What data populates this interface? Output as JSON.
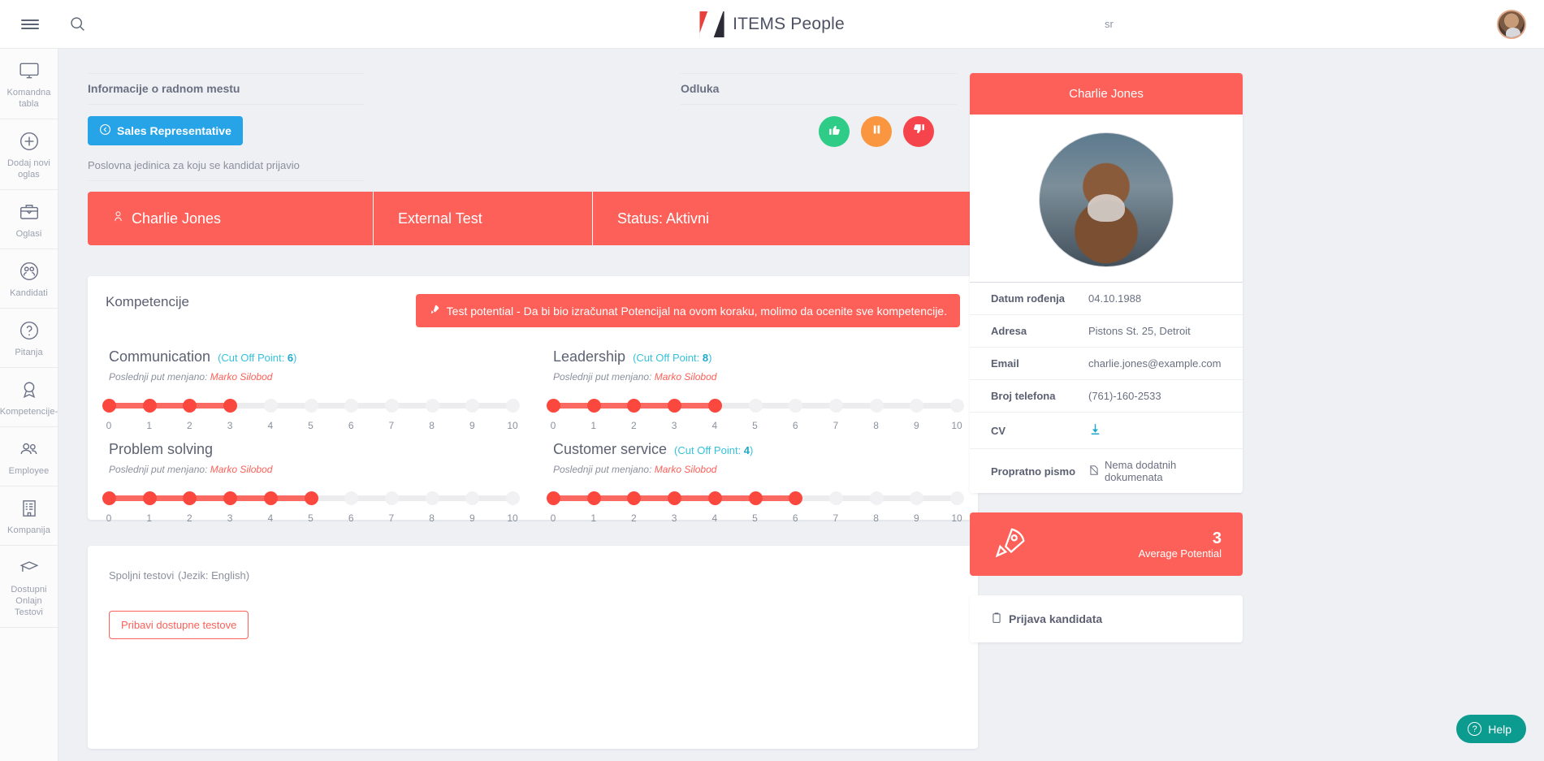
{
  "topbar": {
    "menu_icon": "hamburger-icon",
    "search_icon": "search-icon",
    "brand_title": "ITEMS People",
    "language": "sr",
    "avatar": "user-avatar"
  },
  "sidebar": {
    "items": [
      {
        "label": "Komandna tabla",
        "icon": "monitor-icon"
      },
      {
        "label": "Dodaj novi oglas",
        "icon": "plus-circle-icon"
      },
      {
        "label": "Oglasi",
        "icon": "briefcase-icon"
      },
      {
        "label": "Kandidati",
        "icon": "candidates-icon"
      },
      {
        "label": "Pitanja",
        "icon": "question-circle-icon"
      },
      {
        "label": "Kompetencije-",
        "icon": "award-icon"
      },
      {
        "label": "Employee",
        "icon": "people-icon"
      },
      {
        "label": "Kompanija",
        "icon": "building-icon"
      },
      {
        "label": "Dostupni Onlajn Testovi",
        "icon": "graduation-cap-icon"
      }
    ]
  },
  "job_info": {
    "section_title": "Informacije o radnom mestu",
    "job_button": "Sales Representative",
    "job_button_icon": "back-circle-icon",
    "subtitle": "Poslovna jedinica za koju se kandidat prijavio"
  },
  "decision": {
    "section_title": "Odluka",
    "buttons": [
      {
        "name": "approve",
        "icon": "thumbs-up-icon",
        "color": "#2ecc87"
      },
      {
        "name": "hold",
        "icon": "pause-icon",
        "color": "#fb9640"
      },
      {
        "name": "reject",
        "icon": "thumbs-down-icon",
        "color": "#f5444b"
      }
    ]
  },
  "strip": {
    "candidate_name": "Charlie Jones",
    "candidate_icon": "person-icon",
    "test_name": "External Test",
    "status": "Status: Aktivni"
  },
  "competencies": {
    "title": "Kompetencije",
    "banner": "Test potential - Da bi bio izračunat Potencijal na ovom koraku, molimo da ocenite sve kompetencije.",
    "banner_icon": "rocket-icon",
    "changed_prefix": "Poslednji put menjano:",
    "changed_by": "Marko Silobod",
    "cut_off_prefix": "(Cut Off Point:",
    "items": [
      {
        "name": "Communication",
        "cut_off": "6",
        "value": 3,
        "max": 10
      },
      {
        "name": "Leadership",
        "cut_off": "8",
        "value": 4,
        "max": 10
      },
      {
        "name": "Problem solving",
        "cut_off": "",
        "value": 5,
        "max": 10
      },
      {
        "name": "Customer service",
        "cut_off": "4",
        "value": 6,
        "max": 10
      }
    ]
  },
  "external_tests": {
    "title": "Spoljni testovi",
    "language_note": "(Jezik: English)",
    "button": "Pribavi dostupne testove"
  },
  "candidate": {
    "name": "Charlie Jones",
    "details": [
      {
        "key": "Datum rođenja",
        "value": "04.10.1988",
        "icon": ""
      },
      {
        "key": "Adresa",
        "value": "Pistons St. 25, Detroit",
        "icon": ""
      },
      {
        "key": "Email",
        "value": "charlie.jones@example.com",
        "icon": ""
      },
      {
        "key": "Broj telefona",
        "value": "(761)-160-2533",
        "icon": ""
      },
      {
        "key": "CV",
        "value": "",
        "icon": "download-icon"
      },
      {
        "key": "Propratno pismo",
        "value": "Nema dodatnih dokumenata",
        "icon": "no-document-icon"
      }
    ]
  },
  "potential": {
    "icon": "rocket-icon",
    "number": "3",
    "label": "Average Potential"
  },
  "apply": {
    "title": "Prijava kandidata",
    "icon": "clipboard-icon"
  },
  "help": {
    "label": "Help",
    "icon": "question-circle-icon"
  },
  "colors": {
    "accent_red": "#fc6058",
    "blue": "#27a3e8",
    "cyan": "#36c2dd",
    "green": "#2ecc87",
    "orange": "#fb9640",
    "teal": "#0c9b8f"
  }
}
